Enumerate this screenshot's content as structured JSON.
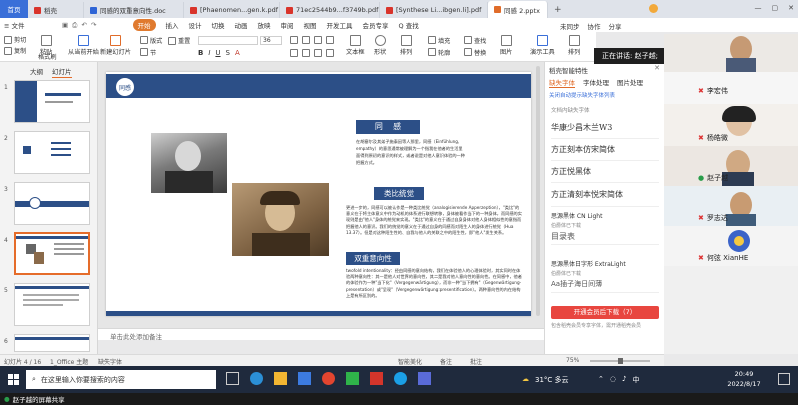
{
  "tabs": {
    "home": "首页",
    "items": [
      {
        "label": "稻壳",
        "color": "#d9342b"
      },
      {
        "label": "同感的双重意向性.doc",
        "color": "#2f65d6"
      },
      {
        "label": "[Phaenomen...gen.k.pdf",
        "color": "#d9342b"
      },
      {
        "label": "71ec2544b9...f3749b.pdf",
        "color": "#d9342b"
      },
      {
        "label": "[Synthese Li...ibgen.li].pdf",
        "color": "#d9342b"
      },
      {
        "label": "同感 2.pptx",
        "color": "#e06c2a"
      }
    ]
  },
  "menu": {
    "file": "≡ 文件",
    "items": [
      "开始",
      "插入",
      "设计",
      "切换",
      "动画",
      "放映",
      "审阅",
      "视图",
      "开发工具",
      "会员专享"
    ],
    "search": "Q 查找",
    "right": [
      "未同步",
      "协作",
      "分享"
    ]
  },
  "ribbon": {
    "cut": "剪切",
    "copy": "复制",
    "format_painter": "格式刷",
    "paste": "粘贴",
    "from_current": "从当前开始",
    "new_slide": "新建幻灯片",
    "layout": "版式",
    "section": "节",
    "reset": "重置",
    "font_size": "36",
    "font_size_small": "0",
    "picture": "图片",
    "fill": "填充",
    "find": "查找",
    "replace": "替换",
    "outline": "轮廓",
    "arrange": "排列",
    "text_box": "文本框",
    "shape": "形状",
    "presenter_tools": "演示工具",
    "sort": "排列"
  },
  "left_panel": {
    "tab_outline": "大纲",
    "tab_slides": "幻灯片"
  },
  "slide": {
    "logo_text": "同感",
    "heading1": "同    感",
    "para1": "在胡塞尔及其弟子施泰因等人那里，同感（Einfühlung, empathy）的意思通常被理解为一个指我在他者的生活里面得到原初的意识的样式，或者说是对他人意识体验的一种把握方式。",
    "heading2": "类比统觉",
    "para2": "更进一步的，同感可以被认作是一种类比统觉（analogisierende Apperzeption），\"类比\"的意义在于将主体意义中作为动机的体系进行联想转移，身体被看作当下的一种身体，而同感的实现则是由\"他人\"身体的统觉来实现。\"类比\"的意义在于通过自身身体对他人身体相似性的意指而把握他人的意识。我们的统觉的意义在于通过自身的同感而对陌生人的身体进行统觉（Hua 13.37）。但是对这种陌生性的、自我与他人的关联之中的陌生性，即\"他人\"发生关系。",
    "heading3": "双重意向性",
    "para3": "twofold intentionality：经由同感的意向结构，我们在体验他人的心理体验时，其实同时在体验两种意向性：其一是他人对世界的意向性，其二是我对他人意向性的意向性。在同感中，他者的体验作为一种\"当下化\"（Vergegenwärtigung），而非一种\"当下拥有\"（Gegenwärtigung-presentation）或\"呈现\"（Vergegenwärtigung:presentification）。两种意向性的内在结构上是有所区别的。"
  },
  "canvas": {
    "notes_placeholder": "单击此处添加备注"
  },
  "font_panel": {
    "title": "稻壳智能特性",
    "tabs": [
      "缺失字体",
      "字体处理",
      "图片处理"
    ],
    "note": "关闭自动提示缺失字体列表",
    "section": "文档内缺失字体",
    "fonts": [
      "华康少昌木兰W3",
      "方正刻本仿宋简体",
      "方正悦黑体",
      "方正清刻本悦宋简体"
    ],
    "preview_fonts": [
      {
        "name": "思源黑体 CN Light",
        "note": "伯爵体已下载",
        "sample": "目录表"
      },
      {
        "name": "思源黑体日字形 ExtraLight",
        "note": "伯爵体已下载",
        "sample": "Aa插子海日间薄"
      }
    ],
    "download_button": "开通会员后下载（7）",
    "footer": "包含稻壳会员专享字体，需开通稻壳会员"
  },
  "video": {
    "speaking": "正在讲话: 赵子越;",
    "participants": [
      "李宏伟",
      "杨皓微",
      "赵子越",
      "罗志达",
      "何弦 XianHE"
    ]
  },
  "status": {
    "slide_info": "幻灯片 4 / 16",
    "theme": "1_Office 主题",
    "missing_font": "缺失字体",
    "smart_beauty": "智能美化",
    "notes": "备注",
    "comment": "批注",
    "zoom": "75%"
  },
  "taskbar": {
    "search_placeholder": "在这里输入你要搜索的内容",
    "weather": "31°C 多云",
    "time": "20:49",
    "date": "2022/8/17"
  },
  "share_bar": {
    "label": "赵子越的屏幕共享"
  }
}
